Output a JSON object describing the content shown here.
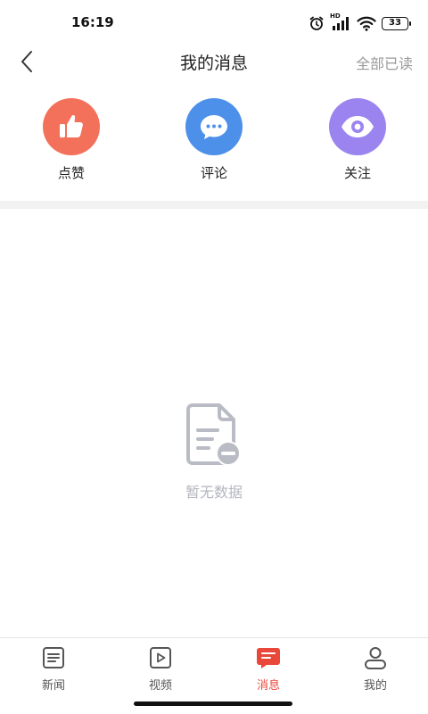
{
  "status_bar": {
    "time": "16:19",
    "network_label": "HD",
    "battery": "33",
    "icons": [
      "alarm-icon",
      "signal-icon",
      "wifi-icon",
      "battery-icon"
    ]
  },
  "header": {
    "back_icon": "chevron-left-icon",
    "title": "我的消息",
    "mark_all_read": "全部已读"
  },
  "categories": [
    {
      "label": "点赞",
      "icon": "thumbs-up-icon",
      "color": "#f3715a"
    },
    {
      "label": "评论",
      "icon": "comment-bubble-icon",
      "color": "#4d90ea"
    },
    {
      "label": "关注",
      "icon": "eye-icon",
      "color": "#9b84ef"
    }
  ],
  "empty_state": {
    "icon": "no-data-document-icon",
    "text": "暂无数据"
  },
  "tab_bar": {
    "tabs": [
      {
        "label": "新闻",
        "icon": "news-icon",
        "active": false
      },
      {
        "label": "视频",
        "icon": "video-icon",
        "active": false
      },
      {
        "label": "消息",
        "icon": "message-icon",
        "active": true
      },
      {
        "label": "我的",
        "icon": "profile-icon",
        "active": false
      }
    ],
    "active_color": "#e9473a"
  }
}
